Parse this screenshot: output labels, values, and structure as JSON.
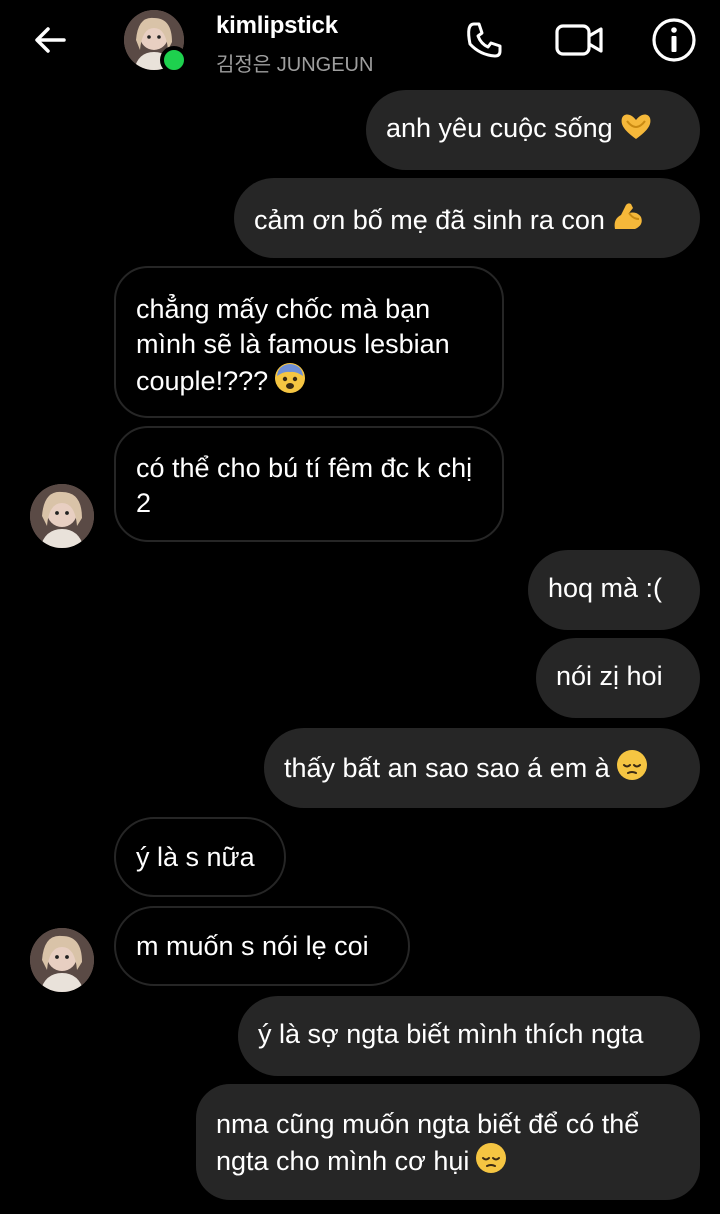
{
  "header": {
    "username": "kimlipstick",
    "subtitle": "김정은 JUNGEUN",
    "back_icon": "arrow-left-icon",
    "phone_icon": "phone-icon",
    "video_icon": "video-camera-icon",
    "info_icon": "info-icon",
    "online_color": "#1ed14e"
  },
  "messages": [
    {
      "from": "me",
      "text": "anh yêu cuộc sống",
      "emoji": "heart-hands-icon"
    },
    {
      "from": "me",
      "text": "cảm ơn bố mẹ đã sinh ra con",
      "emoji": "flexed-biceps-icon"
    },
    {
      "from": "them",
      "text": "chẳng mấy chốc mà bạn mình sẽ là famous lesbian couple!???",
      "emoji": "fearful-face-icon"
    },
    {
      "from": "them",
      "text": "có thể cho bú tí fêm đc k chị 2"
    },
    {
      "from": "me",
      "text": "hoq mà :("
    },
    {
      "from": "me",
      "text": "nói zị hoi"
    },
    {
      "from": "me",
      "text": "thấy bất an sao sao á em à",
      "emoji": "pensive-face-icon"
    },
    {
      "from": "them",
      "text": "ý là s nữa"
    },
    {
      "from": "them",
      "text": "m muốn s nói lẹ coi"
    },
    {
      "from": "me",
      "text": "ý là sợ ngta biết mình thích ngta"
    },
    {
      "from": "me",
      "text": "nma cũng muốn ngta biết để có thể ngta cho mình cơ hụi",
      "emoji": "pensive-face-icon"
    }
  ],
  "colors": {
    "background": "#000000",
    "outgoing_bubble": "#262626",
    "incoming_border": "#262626",
    "subtitle_text": "#9e9e9e"
  }
}
